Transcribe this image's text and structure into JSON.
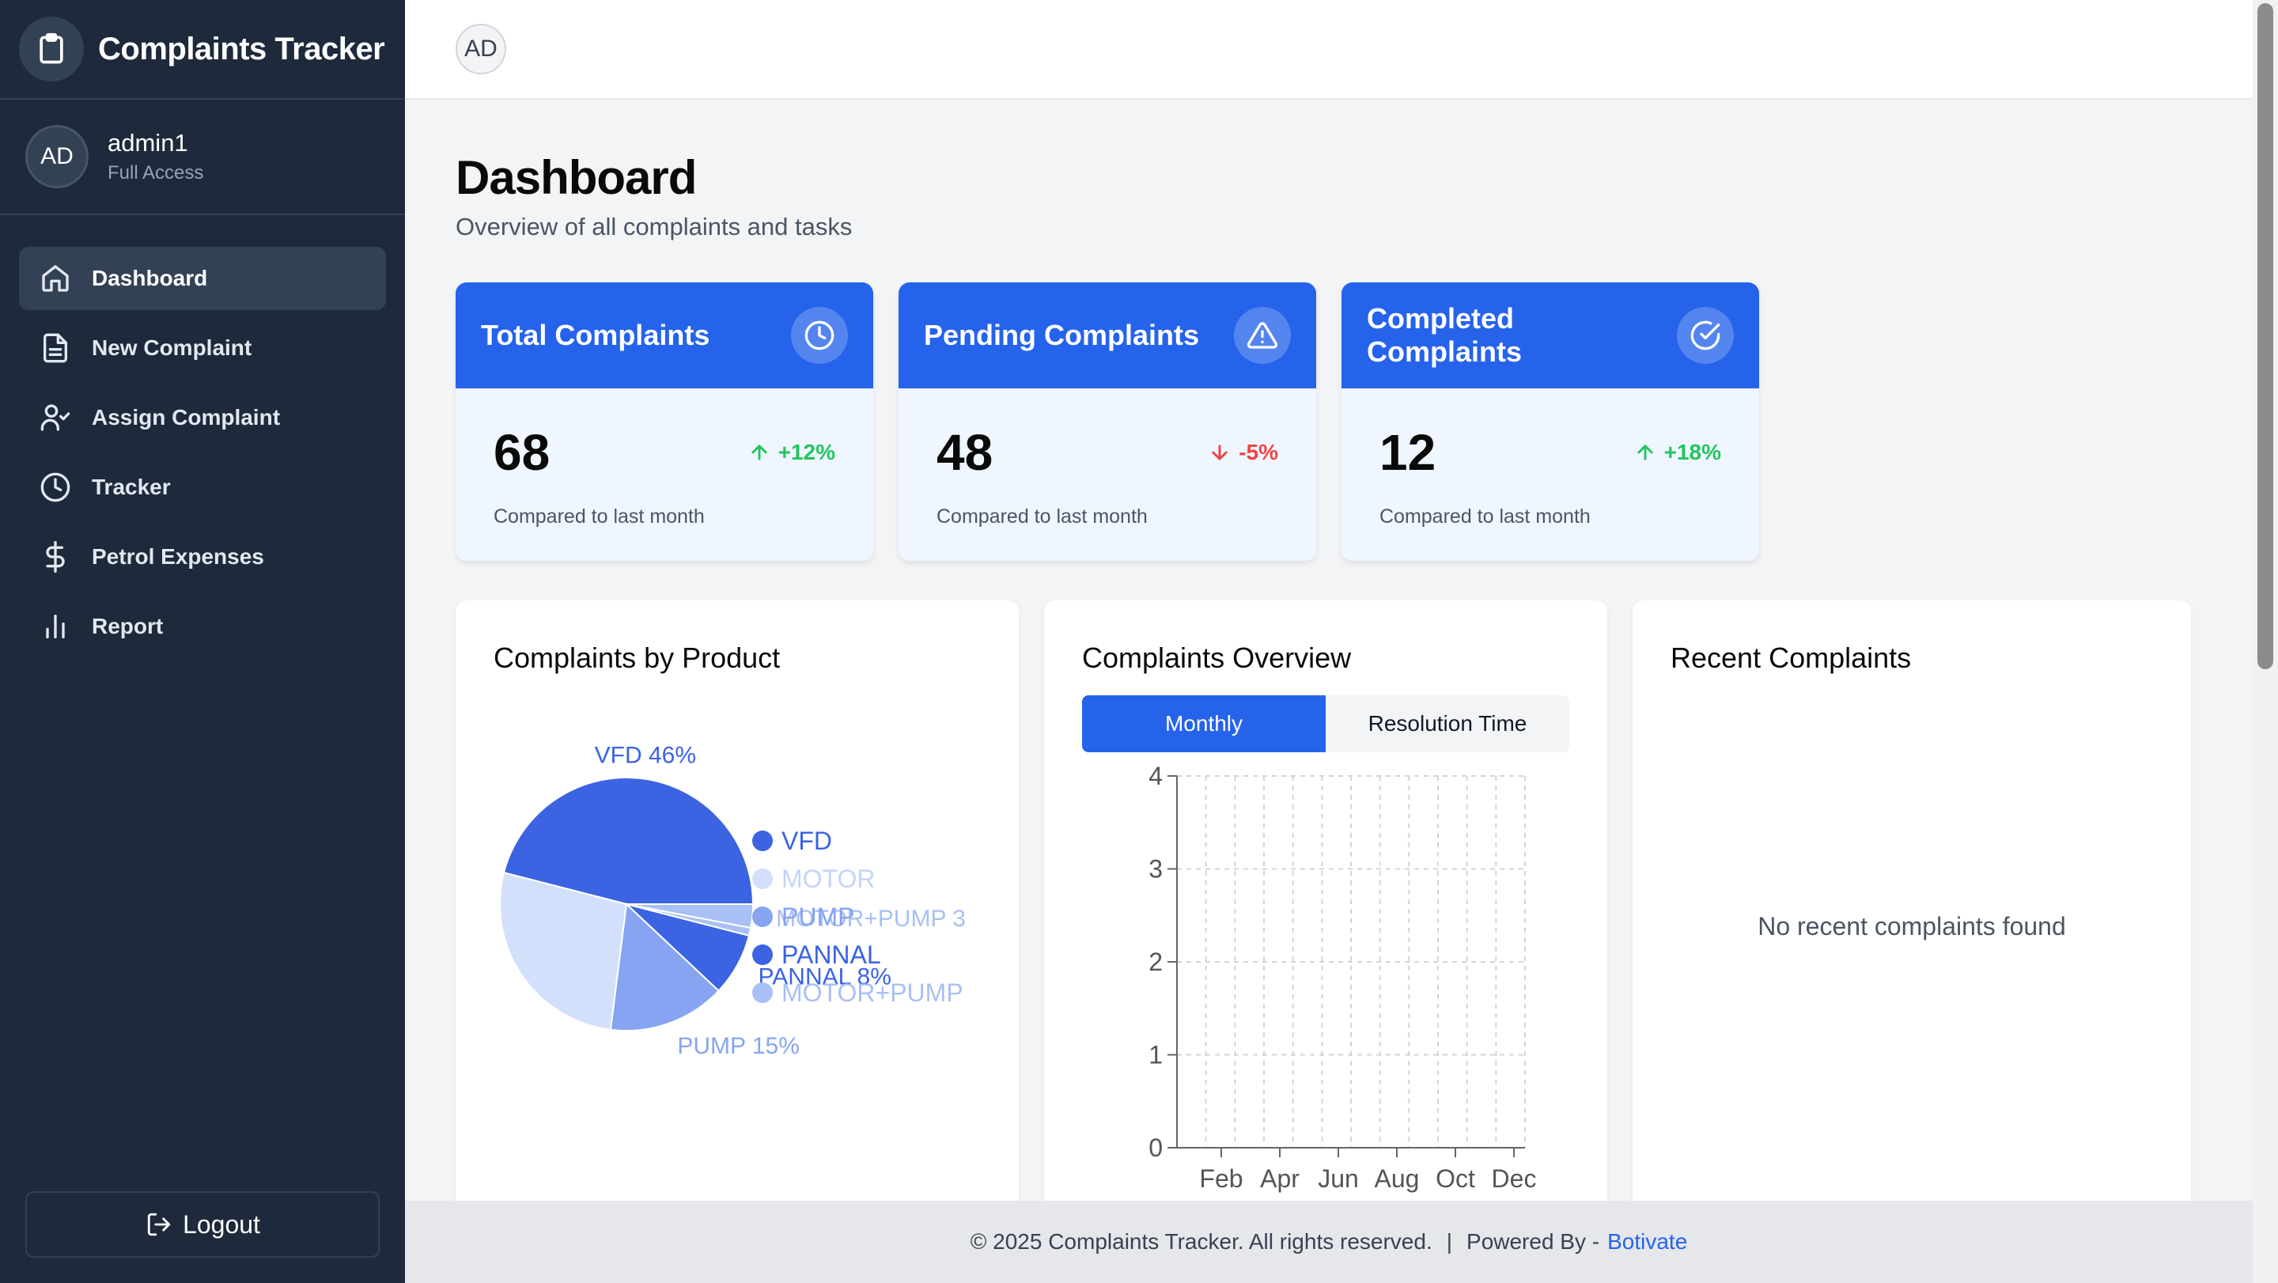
{
  "app": {
    "title": "Complaints Tracker",
    "logo_icon": "clipboard-icon"
  },
  "user": {
    "avatar": "AD",
    "name": "admin1",
    "role": "Full Access"
  },
  "nav": [
    {
      "label": "Dashboard",
      "icon": "home-icon",
      "active": true
    },
    {
      "label": "New Complaint",
      "icon": "document-icon"
    },
    {
      "label": "Assign Complaint",
      "icon": "user-check-icon"
    },
    {
      "label": "Tracker",
      "icon": "clock-icon"
    },
    {
      "label": "Petrol Expenses",
      "icon": "dollar-icon"
    },
    {
      "label": "Report",
      "icon": "bar-chart-icon"
    }
  ],
  "logout_label": "Logout",
  "topbar": {
    "avatar": "AD"
  },
  "page": {
    "title": "Dashboard",
    "subtitle": "Overview of all complaints and tasks"
  },
  "cards": [
    {
      "title": "Total Complaints",
      "icon": "clock-icon",
      "value": "68",
      "change": "+12%",
      "direction": "up",
      "note": "Compared to last month"
    },
    {
      "title": "Pending Complaints",
      "icon": "alert-triangle-icon",
      "value": "48",
      "change": "-5%",
      "direction": "down",
      "note": "Compared to last month"
    },
    {
      "title": "Completed Complaints",
      "icon": "check-circle-icon",
      "value": "12",
      "change": "+18%",
      "direction": "up",
      "note": "Compared to last month"
    }
  ],
  "panels": {
    "product": {
      "title": "Complaints by Product"
    },
    "overview": {
      "title": "Complaints Overview",
      "tabs": [
        "Monthly",
        "Resolution Time"
      ]
    },
    "recent": {
      "title": "Recent Complaints",
      "empty": "No recent complaints found"
    }
  },
  "chart_data": [
    {
      "type": "pie",
      "labels": [
        "VFD",
        "MOTOR",
        "PUMP",
        "PANNAL",
        "MOTOR+PUMP",
        "MOTOR+PUMP 3"
      ],
      "values": [
        46,
        27,
        15,
        8,
        1,
        3
      ],
      "slice_labels": [
        "VFD 46%",
        "",
        "PUMP 15%",
        "PANNAL 8%",
        "",
        "MOTOR+PUMP 3"
      ],
      "legend": [
        "VFD",
        "MOTOR",
        "PUMP",
        "PANNAL",
        "MOTOR+PUMP"
      ],
      "colors": [
        "#3b63e2",
        "#d2e0fb",
        "#86a4f1",
        "#3b63e2",
        "#a8c0f5",
        "#a8c0f5"
      ],
      "legend_placement": "right"
    },
    {
      "type": "line",
      "categories": [
        "Feb",
        "Apr",
        "Jun",
        "Aug",
        "Oct",
        "Dec"
      ],
      "series": [],
      "ylim": [
        0,
        4
      ],
      "yticks": [
        0,
        1,
        2,
        3,
        4
      ],
      "grid": true
    }
  ],
  "footer": {
    "text": "© 2025 Complaints Tracker. All rights reserved.",
    "sep": "|",
    "powered": "Powered By -",
    "link": "Botivate"
  }
}
